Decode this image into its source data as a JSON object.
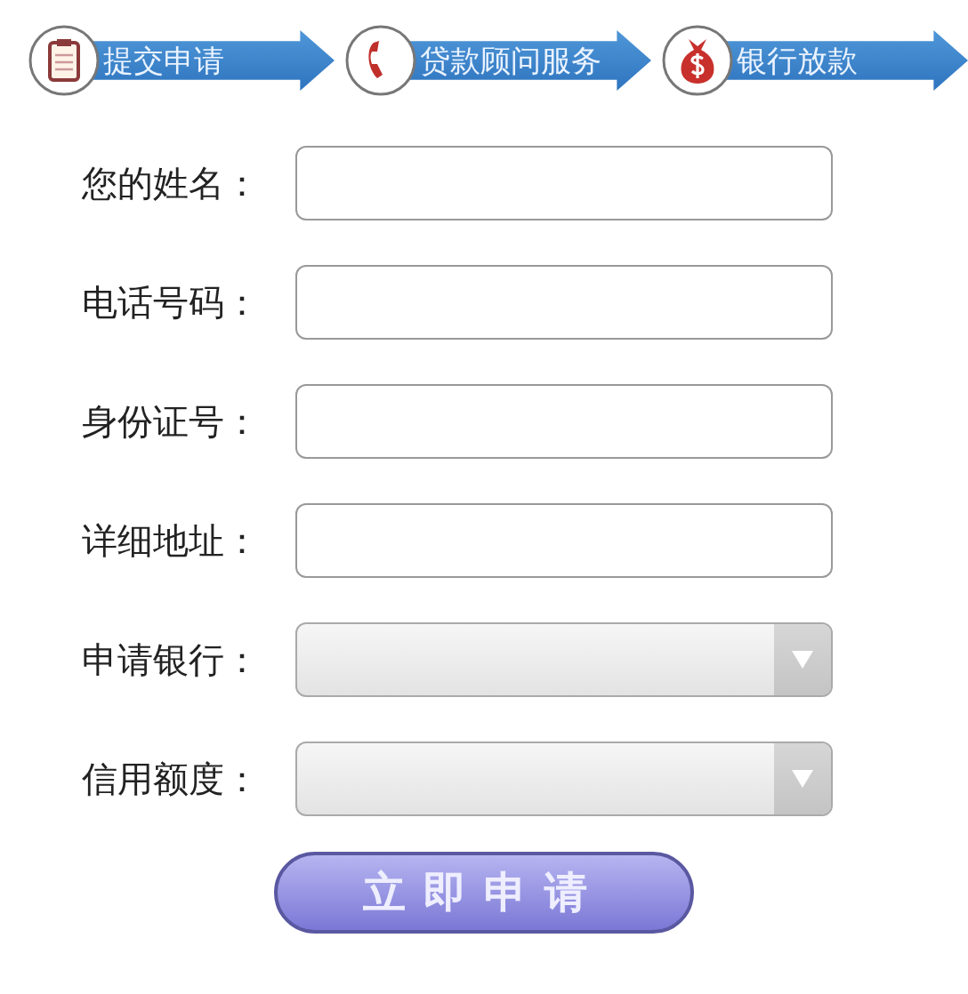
{
  "steps": [
    {
      "kind": "clipboard",
      "label": "提交申请"
    },
    {
      "kind": "phone",
      "label": "贷款顾问服务"
    },
    {
      "kind": "moneybag",
      "label": "银行放款"
    }
  ],
  "fields": [
    {
      "kind": "text",
      "label": "您的姓名："
    },
    {
      "kind": "text",
      "label": "电话号码："
    },
    {
      "kind": "text",
      "label": "身份证号："
    },
    {
      "kind": "text",
      "label": "详细地址："
    },
    {
      "kind": "select",
      "label": "申请银行："
    },
    {
      "kind": "select",
      "label": "信用额度："
    }
  ],
  "submit": "立即申请"
}
